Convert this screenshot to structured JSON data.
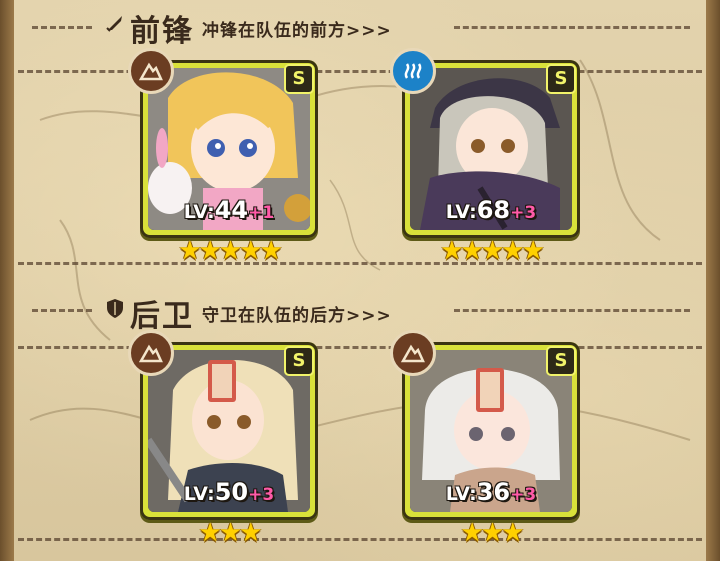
{
  "sections": {
    "front": {
      "title": "前锋",
      "subtitle": "冲锋在队伍的前方>>>",
      "icon": "dagger-icon"
    },
    "back": {
      "title": "后卫",
      "subtitle": "守卫在队伍的后方>>>",
      "icon": "shield-icon"
    }
  },
  "heroes": [
    {
      "slot": "front-1",
      "rarity": "S",
      "class_icon": "mountain-icon",
      "level_label": "LV:",
      "level": "44",
      "bonus": "+1",
      "stars": 5,
      "hair_color": "#f1c55a",
      "accent_color": "#f2a7c5"
    },
    {
      "slot": "front-2",
      "rarity": "S",
      "class_icon": "wave-icon",
      "level_label": "LV:",
      "level": "68",
      "bonus": "+3",
      "stars": 5,
      "hair_color": "#c9c6bb",
      "accent_color": "#4a3a5a"
    },
    {
      "slot": "back-1",
      "rarity": "S",
      "class_icon": "mountain-icon",
      "level_label": "LV:",
      "level": "50",
      "bonus": "+3",
      "stars": 3,
      "hair_color": "#efe0b8",
      "accent_color": "#d45a4a"
    },
    {
      "slot": "back-2",
      "rarity": "S",
      "class_icon": "mountain-icon",
      "level_label": "LV:",
      "level": "36",
      "bonus": "+3",
      "stars": 3,
      "hair_color": "#ecebe8",
      "accent_color": "#d45a4a"
    }
  ]
}
